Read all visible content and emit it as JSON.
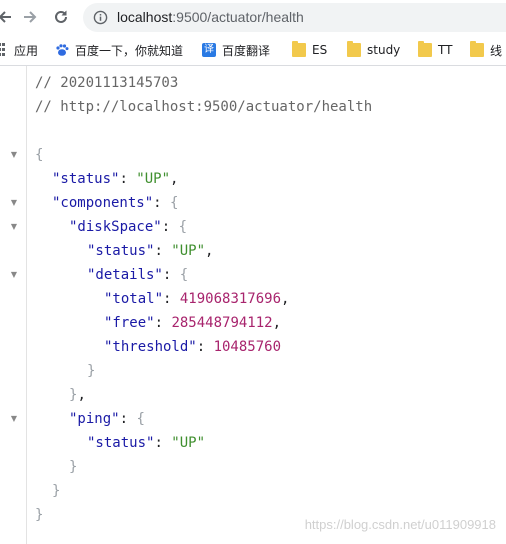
{
  "browser": {
    "url_host": "localhost",
    "url_rest": ":9500/actuator/health",
    "bookmarks": [
      "应用",
      "百度一下，你就知道",
      "百度翻译",
      "ES",
      "study",
      "TT",
      "线"
    ]
  },
  "comments": [
    "// 20201113145703",
    "// http://localhost:9500/actuator/health"
  ],
  "json": {
    "status_key": "\"status\"",
    "status_value": "\"UP\"",
    "components_key": "\"components\"",
    "diskspace_key": "\"diskSpace\"",
    "disk_status_key": "\"status\"",
    "disk_status_value": "\"UP\"",
    "details_key": "\"details\"",
    "total_key": "\"total\"",
    "total_value": "419068317696",
    "free_key": "\"free\"",
    "free_value": "285448794112",
    "threshold_key": "\"threshold\"",
    "threshold_value": "10485760",
    "ping_key": "\"ping\"",
    "ping_status_key": "\"status\"",
    "ping_status_value": "\"UP\""
  },
  "watermark": "https://blog.csdn.net/u011909918",
  "colors": {
    "key": "#1a1aa6",
    "string": "#3f8f2e",
    "number": "#a8246d",
    "comment": "#666666"
  }
}
